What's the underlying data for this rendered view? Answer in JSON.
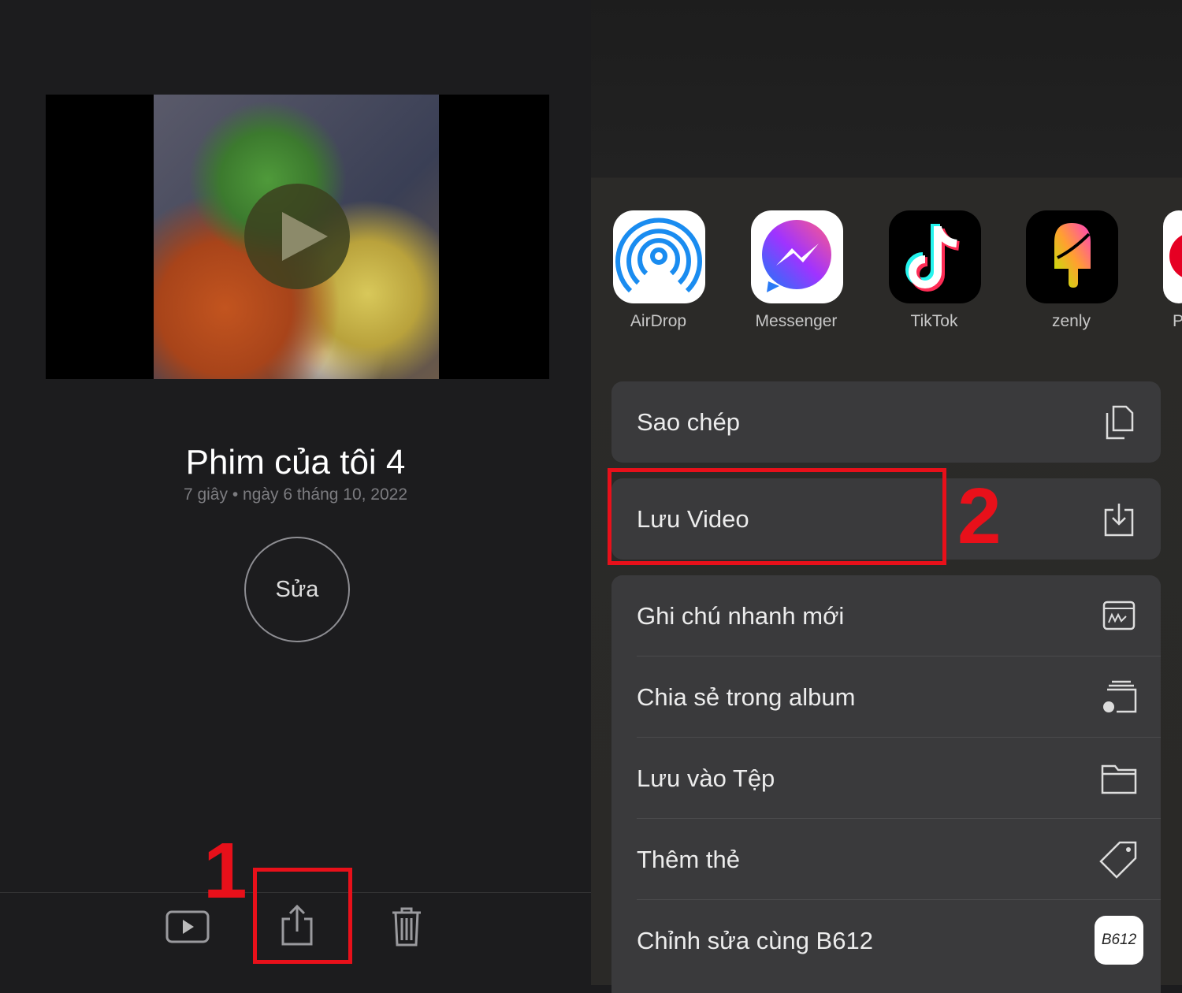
{
  "video": {
    "title": "Phim của tôi 4",
    "subtitle": "7 giây • ngày 6 tháng 10, 2022",
    "edit_label": "Sửa"
  },
  "toolbar": {
    "icons": [
      "play-icon",
      "share-icon",
      "trash-icon"
    ]
  },
  "annotations": {
    "step1": "1",
    "step2": "2",
    "color": "#e8101a"
  },
  "share_apps": [
    {
      "label": "AirDrop"
    },
    {
      "label": "Messenger"
    },
    {
      "label": "TikTok"
    },
    {
      "label": "zenly"
    },
    {
      "label": "P"
    }
  ],
  "actions": [
    {
      "label": "Sao chép",
      "icon": "copy-icon"
    },
    {
      "label": "Lưu Video",
      "icon": "save-download-icon"
    },
    {
      "label": "Ghi chú nhanh mới",
      "icon": "quick-note-icon"
    },
    {
      "label": "Chia sẻ trong album",
      "icon": "shared-album-icon"
    },
    {
      "label": "Lưu vào Tệp",
      "icon": "folder-icon"
    },
    {
      "label": "Thêm thẻ",
      "icon": "tag-icon"
    },
    {
      "label": "Chỉnh sửa cùng B612",
      "icon": "b612-icon",
      "badge": "B612"
    }
  ]
}
